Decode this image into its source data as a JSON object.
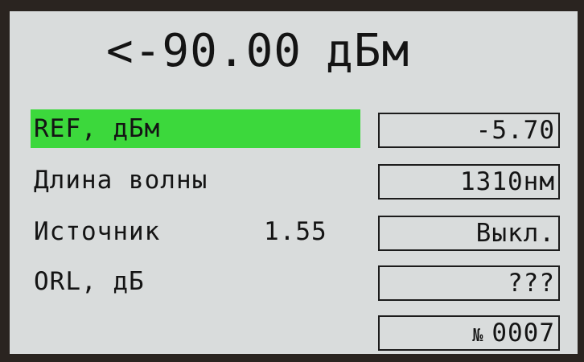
{
  "reading": {
    "value": "<-90.00",
    "unit": "дБм"
  },
  "rows": [
    {
      "label": "REF, дБм",
      "value": "-5.70",
      "highlighted": true
    },
    {
      "label": "Длина волны",
      "value": "1310нм"
    },
    {
      "label": "Источник",
      "extra": "1.55",
      "value": "Выкл."
    },
    {
      "label": "ORL, дБ",
      "value": "???"
    }
  ],
  "counter": {
    "sign": "№",
    "value": "0007"
  },
  "colors": {
    "screen_background": "#d9dcdc",
    "highlight": "#3cd83c",
    "text": "#141414"
  }
}
